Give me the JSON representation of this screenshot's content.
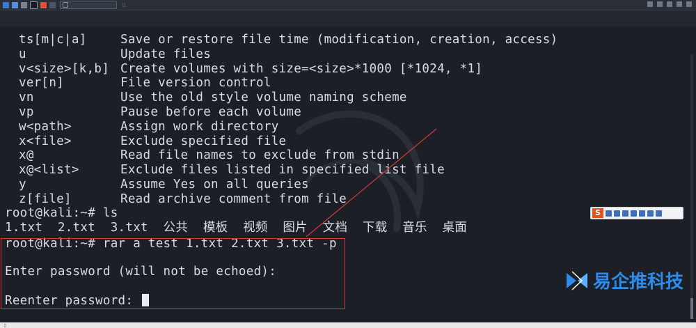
{
  "terminal": {
    "options": [
      {
        "opt": "ts[m|c|a]",
        "desc": "Save or restore file time (modification, creation, access)"
      },
      {
        "opt": "u",
        "desc": "Update files"
      },
      {
        "opt": "v<size>[k,b]",
        "desc": "Create volumes with size=<size>*1000 [*1024, *1]"
      },
      {
        "opt": "ver[n]",
        "desc": "File version control"
      },
      {
        "opt": "vn",
        "desc": "Use the old style volume naming scheme"
      },
      {
        "opt": "vp",
        "desc": "Pause before each volume"
      },
      {
        "opt": "w<path>",
        "desc": "Assign work directory"
      },
      {
        "opt": "x<file>",
        "desc": "Exclude specified file"
      },
      {
        "opt": "x@",
        "desc": "Read file names to exclude from stdin"
      },
      {
        "opt": "x@<list>",
        "desc": "Exclude files listed in specified list file"
      },
      {
        "opt": "y",
        "desc": "Assume Yes on all queries"
      },
      {
        "opt": "z[file]",
        "desc": "Read archive comment from file"
      }
    ],
    "prompt_ls": "root@kali:~# ls",
    "ls_output": "1.txt  2.txt  3.txt  公共  模板  视频  图片  文档  下载  音乐  桌面",
    "prompt_rar": "root@kali:~# rar a test 1.txt 2.txt 3.txt -p",
    "enter_password": "Enter password (will not be echoed):",
    "reenter_password": "Reenter password: "
  },
  "watermark": {
    "text": "易企推科技",
    "color": "#2f8bea"
  },
  "ime_toolbar": {
    "logo_letter": "S"
  },
  "colors": {
    "background": "#1c1f26",
    "text": "#d9dde3",
    "highlight_box": "#d33a3a"
  }
}
